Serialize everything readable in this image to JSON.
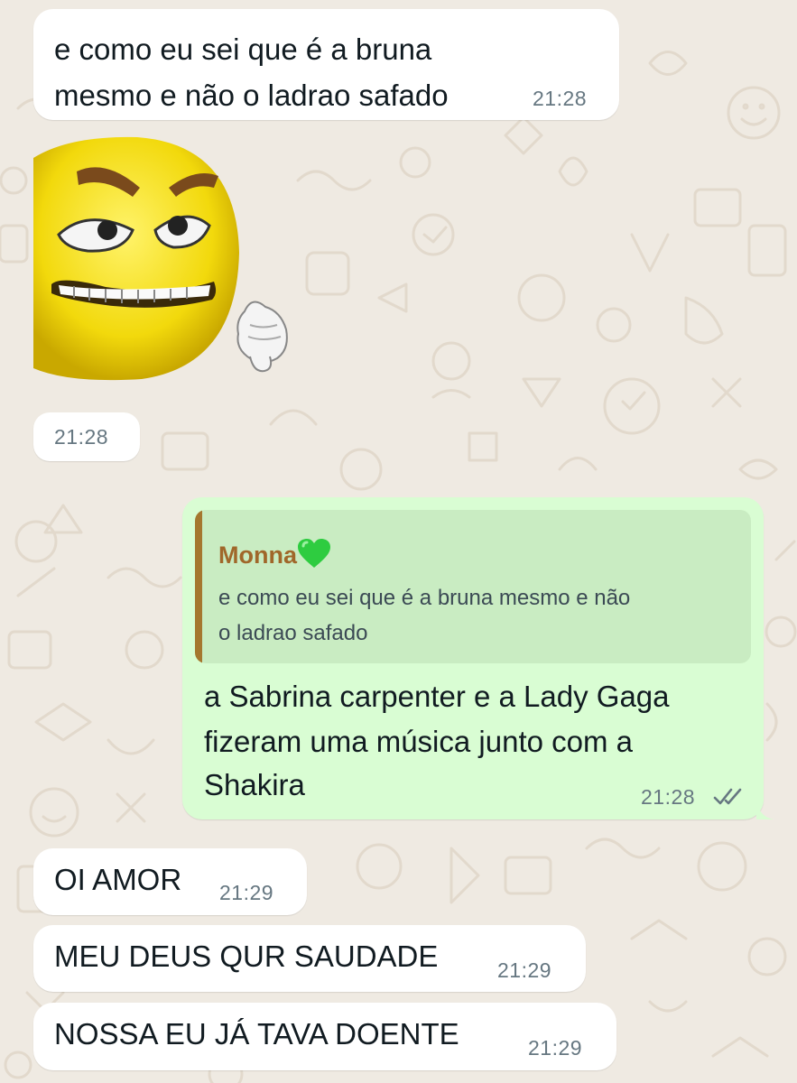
{
  "colors": {
    "chat_background": "#efeae2",
    "incoming_bubble": "#ffffff",
    "outgoing_bubble": "#d9fdd3",
    "quote_background": "#c9ecc2",
    "quote_author": "#a0672a",
    "timestamp": "#667781"
  },
  "messages": [
    {
      "direction": "incoming",
      "text_line1": "e como eu sei que é a bruna",
      "text_line2": "mesmo e não o ladrao safado",
      "time": "21:28"
    },
    {
      "direction": "incoming",
      "type": "sticker",
      "sticker": "angry-emoji-thumbs-down-icon",
      "time": "21:28"
    },
    {
      "direction": "outgoing",
      "quoted": {
        "author": "Monna",
        "author_emoji": "green-heart-icon",
        "text_line1": "e como eu sei que é a bruna mesmo e não",
        "text_line2": "o ladrao safado"
      },
      "text_line1": "a Sabrina carpenter e a Lady Gaga",
      "text_line2": "fizeram uma música junto com a",
      "text_line3": "Shakira",
      "time": "21:28",
      "status_icon": "double-check-icon"
    },
    {
      "direction": "incoming",
      "text": "OI AMOR",
      "time": "21:29"
    },
    {
      "direction": "incoming",
      "text": "MEU DEUS QUR SAUDADE",
      "time": "21:29"
    },
    {
      "direction": "incoming",
      "text": "NOSSA EU JÁ TAVA DOENTE",
      "time": "21:29"
    }
  ]
}
